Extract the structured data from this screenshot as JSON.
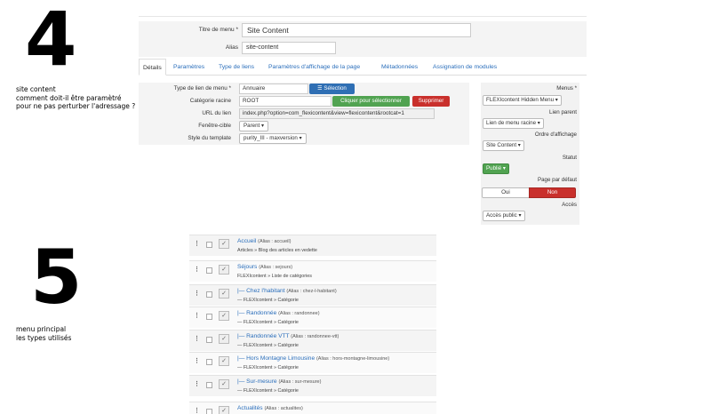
{
  "left_annotations": {
    "step1_number": "4",
    "step1_note": [
      "site content",
      "comment doit-il être paramètré",
      "pour ne pas perturber l'adressage ?"
    ],
    "step2_number": "5",
    "step2_note": [
      "menu principal",
      "les types utilisés"
    ]
  },
  "form": {
    "title_label": "Titre de menu *",
    "title_value": "Site Content",
    "alias_label": "Alias",
    "alias_value": "site-content"
  },
  "tabs": [
    "Détails",
    "Paramètres",
    "Type de liens",
    "Paramètres d'affichage de la page",
    "Métadonnées",
    "Assignation de modules"
  ],
  "details": {
    "link_type_label": "Type de lien de menu *",
    "link_type_value": "Annuaire",
    "select_button": "Sélection",
    "root_cat_label": "Catégorie racine",
    "root_cat_value": "ROOT",
    "pick_button": "Cliquer pour sélectionner",
    "delete_button": "Supprimer",
    "url_label": "URL du lien",
    "url_value": "index.php?option=com_flexicontent&view=flexicontent&rootcat=1",
    "target_label": "Fenêtre-cible",
    "target_value": "Parent",
    "template_label": "Style du template",
    "template_value": "purity_III - maxversion"
  },
  "side": {
    "menus_label": "Menus *",
    "menus_value": "FLEXIcontent Hidden Menu",
    "parent_label": "Lien parent",
    "parent_value": "Lien de menu racine",
    "order_label": "Ordre d'affichage",
    "order_value": "Site Content",
    "status_label": "Statut",
    "status_value": "Publié",
    "default_label": "Page par défaut",
    "yes": "Oui",
    "no": "Non",
    "access_label": "Accès",
    "access_value": "Accès public"
  },
  "menu_items": [
    {
      "title": "Accueil",
      "alias": "(Alias : accueil)",
      "type": "Articles » Blog des articles en vedette"
    },
    {
      "title": "Séjours",
      "alias": "(Alias : sejours)",
      "type": "FLEXIcontent » Liste de catégories"
    },
    {
      "title": "|— Chez l'habitant",
      "alias": "(Alias : chez-l-habitant)",
      "type": "— FLEXIcontent » Catégorie"
    },
    {
      "title": "|— Randonnée",
      "alias": "(Alias : randonnee)",
      "type": "— FLEXIcontent » Catégorie"
    },
    {
      "title": "|— Randonnée VTT",
      "alias": "(Alias : randonnee-vtt)",
      "type": "— FLEXIcontent » Catégorie"
    },
    {
      "title": "|— Hors Montagne Limousine",
      "alias": "(Alias : hors-montagne-limousine)",
      "type": "— FLEXIcontent » Catégorie"
    },
    {
      "title": "|— Sur-mesure",
      "alias": "(Alias : sur-mesure)",
      "type": "— FLEXIcontent » Catégorie"
    },
    {
      "title": "Actualités",
      "alias": "(Alias : actualites)",
      "type": ""
    }
  ]
}
